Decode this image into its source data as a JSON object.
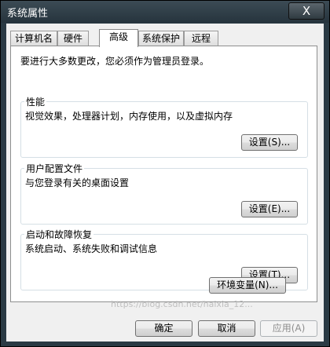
{
  "window": {
    "title": "系统属性",
    "close_glyph": "X"
  },
  "tabs": [
    {
      "label": "计算机名",
      "active": false
    },
    {
      "label": "硬件",
      "active": false
    },
    {
      "label": "高级",
      "active": true
    },
    {
      "label": "系统保护",
      "active": false
    },
    {
      "label": "远程",
      "active": false
    }
  ],
  "notice": "要进行大多数更改，您必须作为管理员登录。",
  "groups": {
    "performance": {
      "title": "性能",
      "desc": "视觉效果，处理器计划，内存使用，以及虚拟内存",
      "button": "设置(S)..."
    },
    "user_profiles": {
      "title": "用户配置文件",
      "desc": "与您登录有关的桌面设置",
      "button": "设置(E)..."
    },
    "startup_recovery": {
      "title": "启动和故障恢复",
      "desc": "系统启动、系统失败和调试信息",
      "button": "设置(T)..."
    }
  },
  "env_button": "环境变量(N)...",
  "footer": {
    "ok": "确定",
    "cancel": "取消",
    "apply": "应用(A)"
  },
  "watermark": "https://blog.csdn.net/haixia_12..."
}
